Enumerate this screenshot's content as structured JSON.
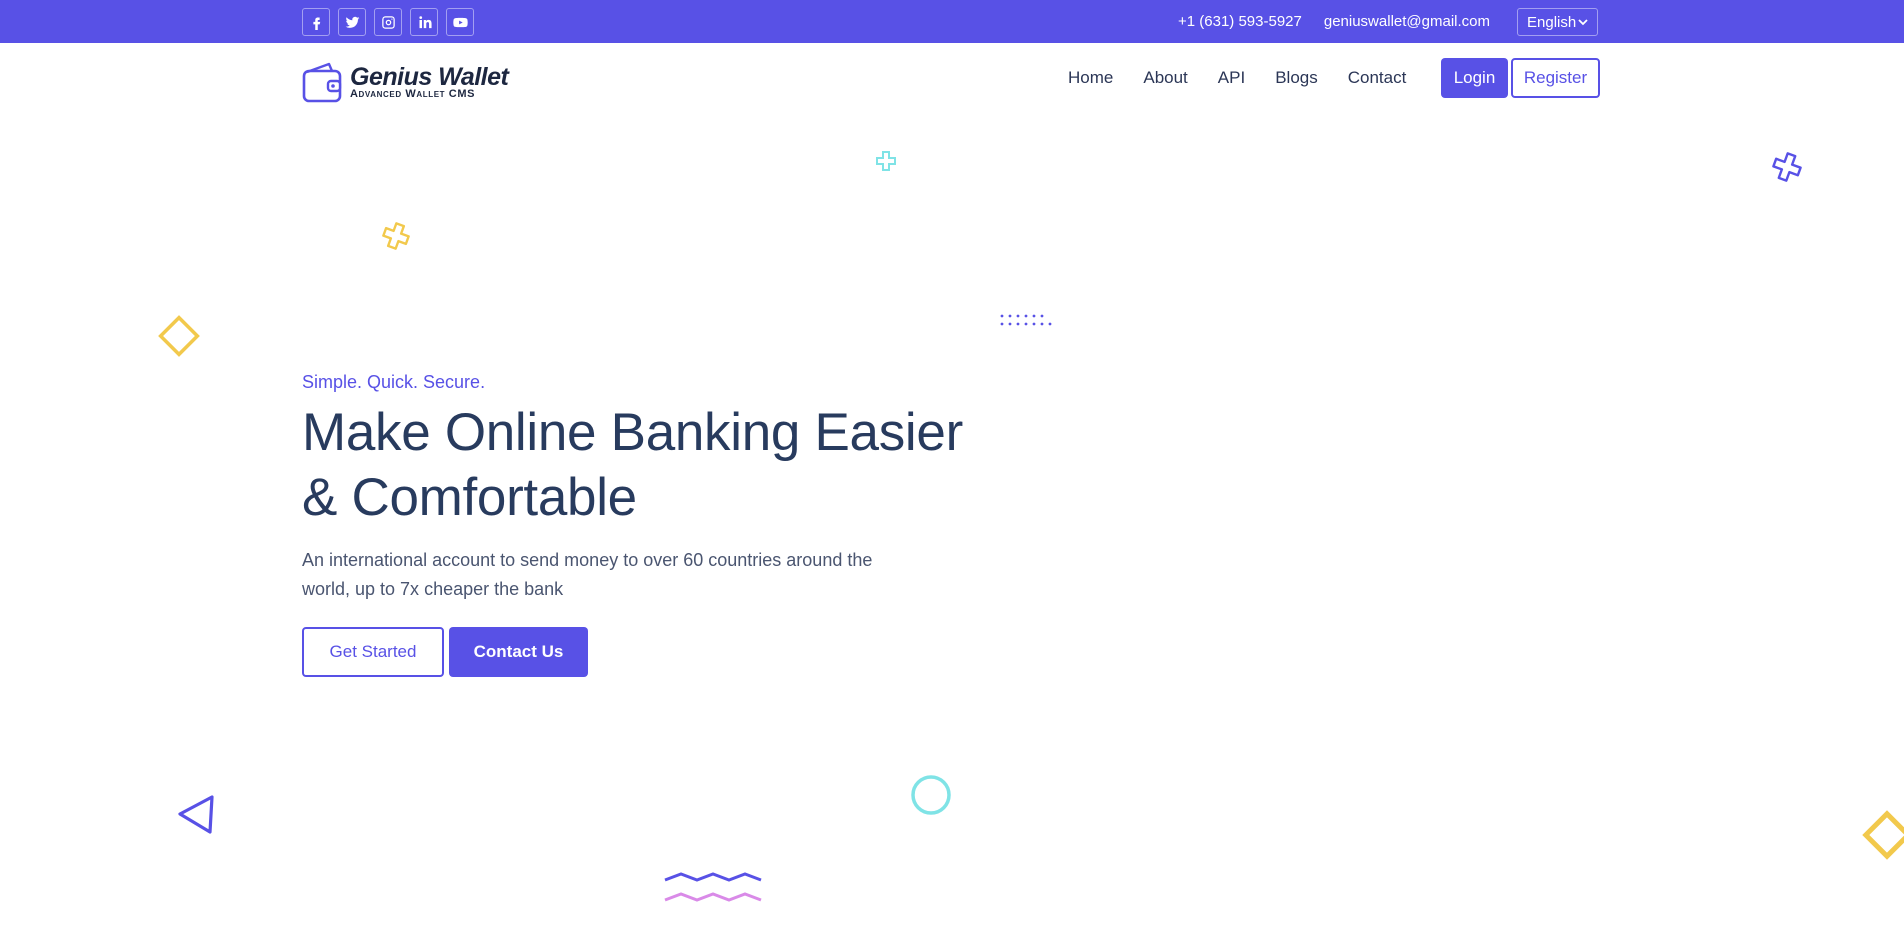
{
  "topbar": {
    "social": [
      {
        "icon": "facebook-icon",
        "glyph": "f"
      },
      {
        "icon": "twitter-icon",
        "glyph": ""
      },
      {
        "icon": "instagram-icon",
        "glyph": ""
      },
      {
        "icon": "linkedin-icon",
        "glyph": "in"
      },
      {
        "icon": "youtube-icon",
        "glyph": ""
      }
    ],
    "phone": "+1 (631) 593-5927",
    "email": "geniuswallet@gmail.com",
    "language": "English"
  },
  "header": {
    "logo_name": "Genius Wallet",
    "logo_tagline": "Advanced Wallet CMS",
    "nav": [
      "Home",
      "About",
      "API",
      "Blogs",
      "Contact"
    ],
    "login_label": "Login",
    "register_label": "Register"
  },
  "hero": {
    "tagline": "Simple. Quick. Secure.",
    "headline": "Make Online Banking Easier & Comfortable",
    "subtext": "An international account to send money to over 60 countries around the world, up to 7x cheaper the bank",
    "primary_label": "Get Started",
    "secondary_label": "Contact Us"
  },
  "colors": {
    "brand": "#5851e6",
    "heading": "#283b5e",
    "accent_yellow": "#f2c94c",
    "accent_cyan": "#7fe3e6",
    "accent_pink": "#d98ae8"
  }
}
